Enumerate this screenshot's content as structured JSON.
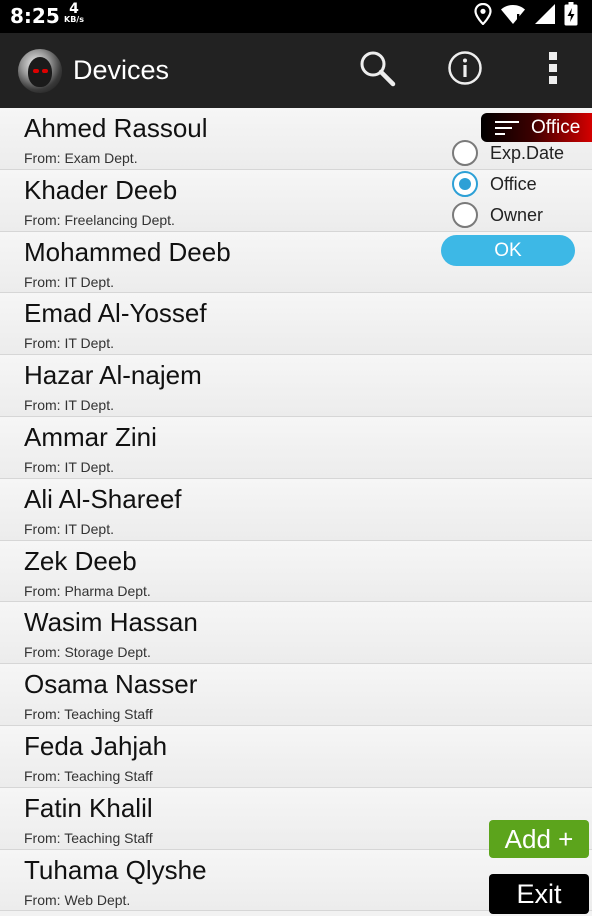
{
  "status_bar": {
    "time": "8:25",
    "net_speed_value": "4",
    "net_speed_unit": "KB/s",
    "icons": [
      "location-icon",
      "wifi-icon",
      "cell-signal-icon",
      "battery-charging-icon"
    ]
  },
  "app_bar": {
    "title": "Devices",
    "icons": [
      "app-logo",
      "search-icon",
      "info-icon",
      "overflow-menu-icon"
    ]
  },
  "devices": [
    {
      "name": "Ahmed Rassoul",
      "dept": "From: Exam Dept."
    },
    {
      "name": "Khader Deeb",
      "dept": "From: Freelancing Dept."
    },
    {
      "name": "Mohammed Deeb",
      "dept": "From: IT Dept."
    },
    {
      "name": "Emad Al-Yossef",
      "dept": "From: IT Dept."
    },
    {
      "name": "Hazar Al-najem",
      "dept": "From: IT Dept."
    },
    {
      "name": "Ammar Zini",
      "dept": "From: IT Dept."
    },
    {
      "name": "Ali Al-Shareef",
      "dept": "From: IT Dept."
    },
    {
      "name": "Zek Deeb",
      "dept": "From: Pharma Dept."
    },
    {
      "name": "Wasim Hassan",
      "dept": "From: Storage Dept."
    },
    {
      "name": "Osama Nasser",
      "dept": "From: Teaching Staff"
    },
    {
      "name": "Feda Jahjah",
      "dept": "From: Teaching Staff"
    },
    {
      "name": "Fatin Khalil",
      "dept": "From: Teaching Staff"
    },
    {
      "name": "Tuhama Qlyshe",
      "dept": "From: Web Dept."
    }
  ],
  "sort_panel": {
    "current_label": "Office",
    "options": [
      {
        "label": "Exp.Date",
        "checked": false
      },
      {
        "label": "Office",
        "checked": true
      },
      {
        "label": "Owner",
        "checked": false
      }
    ],
    "ok_label": "OK"
  },
  "buttons": {
    "add_label": "Add +",
    "exit_label": "Exit"
  },
  "colors": {
    "app_bar": "#222222",
    "accent_radio": "#2da0d6",
    "ok_button": "#3db8e6",
    "add_button": "#5ca41c",
    "sort_chip_red": "#d40000"
  }
}
